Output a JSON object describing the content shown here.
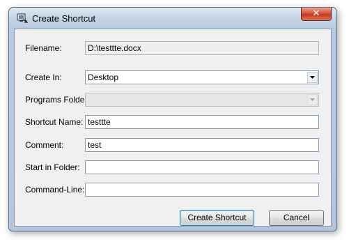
{
  "window": {
    "title": "Create Shortcut",
    "close_glyph": "✕"
  },
  "form": {
    "filename_label": "Filename:",
    "filename_value": "D:\\testtte.docx",
    "create_in_label": "Create In:",
    "create_in_value": "Desktop",
    "programs_folder_label": "Programs Folder:",
    "programs_folder_value": "",
    "shortcut_name_label": "Shortcut Name:",
    "shortcut_name_value": "testtte",
    "comment_label": "Comment:",
    "comment_value": "test",
    "start_in_label": "Start in Folder:",
    "start_in_value": "",
    "command_line_label": "Command-Line:",
    "command_line_value": ""
  },
  "buttons": {
    "create": "Create Shortcut",
    "cancel": "Cancel"
  },
  "icons": {
    "app": "shortcut-app-icon",
    "dropdown": "chevron-down-icon",
    "close": "close-icon"
  }
}
